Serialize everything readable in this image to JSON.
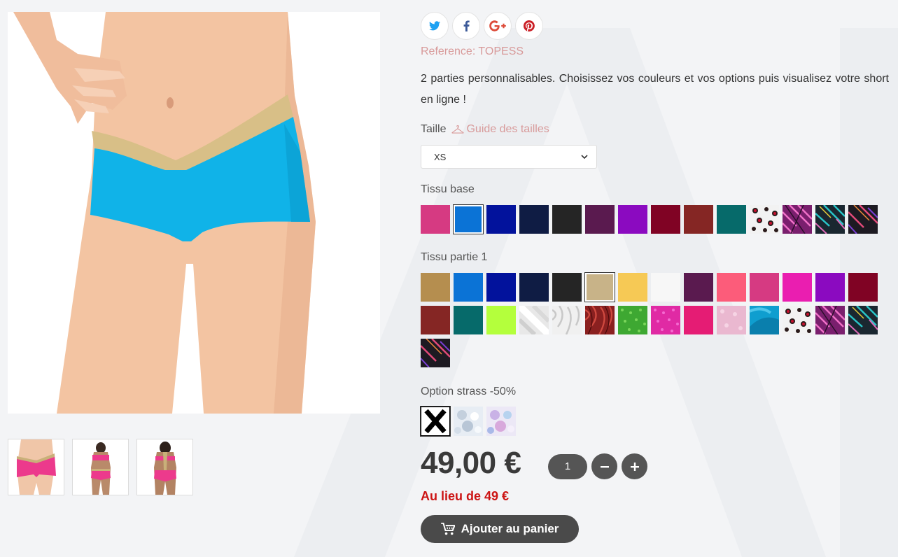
{
  "product": {
    "reference": "Reference: TOPESS",
    "description": "2 parties personnalisables. Choisissez vos couleurs et vos options puis visualisez votre short en ligne !",
    "main_image": "model-wearing-blue-shorts-with-gold-waistband",
    "thumbnails": [
      "pink-shorts-front",
      "pink-set-full-front",
      "pink-set-full-back"
    ]
  },
  "social": [
    {
      "name": "twitter-icon",
      "color": "#1da1f2"
    },
    {
      "name": "facebook-icon",
      "color": "#3b5998"
    },
    {
      "name": "google-plus-icon",
      "color": "#dd4b39"
    },
    {
      "name": "pinterest-icon",
      "color": "#cb2027"
    }
  ],
  "size": {
    "label": "Taille",
    "guide_label": "Guide des tailles",
    "guide_icon": "hanger-icon",
    "selected": "XS"
  },
  "tissu_base": {
    "label": "Tissu base",
    "swatches": [
      {
        "color": "#d63a82",
        "selected": false
      },
      {
        "color": "#0b73d6",
        "selected": true
      },
      {
        "color": "#02129c",
        "selected": false
      },
      {
        "color": "#0f1c44",
        "selected": false
      },
      {
        "color": "#252525",
        "selected": false
      },
      {
        "color": "#5a1a4f",
        "selected": false
      },
      {
        "color": "#8b0ac0",
        "selected": false
      },
      {
        "color": "#800324",
        "selected": false
      },
      {
        "color": "#852624",
        "selected": false
      },
      {
        "color": "#066a6a",
        "selected": false
      },
      {
        "color": "pattern-leopard-red",
        "selected": false
      },
      {
        "color": "pattern-feathers-pink",
        "selected": false
      },
      {
        "color": "pattern-feathers-teal",
        "selected": false
      },
      {
        "color": "pattern-feathers-dark",
        "selected": false
      }
    ]
  },
  "tissu_partie_1": {
    "label": "Tissu partie 1",
    "swatches": [
      {
        "color": "#b58e4f",
        "selected": false
      },
      {
        "color": "#0b73d6",
        "selected": false
      },
      {
        "color": "#02129c",
        "selected": false
      },
      {
        "color": "#0f1c44",
        "selected": false
      },
      {
        "color": "#252525",
        "selected": false
      },
      {
        "color": "#c8b388",
        "selected": true
      },
      {
        "color": "#f6c955",
        "selected": false
      },
      {
        "color": "#f7f7f7",
        "selected": false
      },
      {
        "color": "#5a1a4f",
        "selected": false
      },
      {
        "color": "#fc5c7a",
        "selected": false
      },
      {
        "color": "#d63a82",
        "selected": false
      },
      {
        "color": "#ea1eb0",
        "selected": false
      },
      {
        "color": "#8b0ac0",
        "selected": false
      },
      {
        "color": "#800324",
        "selected": false
      },
      {
        "color": "#852624",
        "selected": false
      },
      {
        "color": "#066a6a",
        "selected": false
      },
      {
        "color": "#b4ff3c",
        "selected": false
      },
      {
        "color": "pattern-silver",
        "selected": false
      },
      {
        "color": "pattern-zebra-white",
        "selected": false
      },
      {
        "color": "pattern-zebra-red",
        "selected": false
      },
      {
        "color": "pattern-green-glitter",
        "selected": false
      },
      {
        "color": "pattern-pink-glitter",
        "selected": false
      },
      {
        "color": "#e51c74",
        "selected": false
      },
      {
        "color": "pattern-light-pink",
        "selected": false
      },
      {
        "color": "pattern-turquoise",
        "selected": false
      },
      {
        "color": "pattern-leopard-red",
        "selected": false
      },
      {
        "color": "pattern-feathers-pink",
        "selected": false
      },
      {
        "color": "pattern-feathers-teal",
        "selected": false
      },
      {
        "color": "pattern-feathers-dark",
        "selected": false
      }
    ]
  },
  "strass": {
    "label": "Option strass -50%",
    "options": [
      "none-x",
      "crystal-clear",
      "crystal-ab"
    ]
  },
  "pricing": {
    "price": "49,00 €",
    "quantity": "1",
    "old_price": "Au lieu de 49 €",
    "add_to_cart": "Ajouter au panier"
  }
}
